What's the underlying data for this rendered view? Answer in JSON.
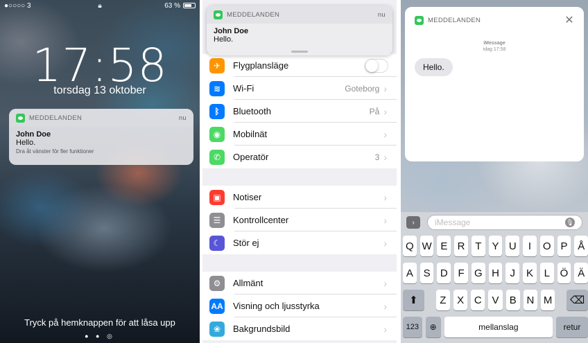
{
  "lock_screen": {
    "status_left": "●○○○○ 3",
    "status_right": "63 %",
    "time": "17:58",
    "date": "torsdag 13 oktober",
    "notification": {
      "app": "MEDDELANDEN",
      "when": "nu",
      "sender": "John Doe",
      "message": "Hello.",
      "hint": "Dra åt vänster för fler funktioner"
    },
    "unlock_text": "Tryck på hemknappen för att låsa upp"
  },
  "settings": {
    "banner": {
      "app": "MEDDELANDEN",
      "when": "nu",
      "sender": "John Doe",
      "message": "Hello."
    },
    "group1": [
      {
        "label": "Flygplansläge",
        "value": "",
        "color": "#ff9500",
        "icon": "airplane-icon",
        "glyph": "✈",
        "toggle": true
      },
      {
        "label": "Wi-Fi",
        "value": "Goteborg",
        "color": "#007aff",
        "icon": "wifi-icon",
        "glyph": "≋"
      },
      {
        "label": "Bluetooth",
        "value": "På",
        "color": "#007aff",
        "icon": "bluetooth-icon",
        "glyph": "ᛒ"
      },
      {
        "label": "Mobilnät",
        "value": "",
        "color": "#4cd964",
        "icon": "cellular-icon",
        "glyph": "◉"
      },
      {
        "label": "Operatör",
        "value": "3",
        "color": "#4cd964",
        "icon": "phone-icon",
        "glyph": "✆"
      }
    ],
    "group2": [
      {
        "label": "Notiser",
        "value": "",
        "color": "#ff3b30",
        "icon": "notifications-icon",
        "glyph": "▣"
      },
      {
        "label": "Kontrollcenter",
        "value": "",
        "color": "#8e8e93",
        "icon": "control-center-icon",
        "glyph": "☰"
      },
      {
        "label": "Stör ej",
        "value": "",
        "color": "#5856d6",
        "icon": "moon-icon",
        "glyph": "☾"
      }
    ],
    "group3": [
      {
        "label": "Allmänt",
        "value": "",
        "color": "#8e8e93",
        "icon": "gear-icon",
        "glyph": "⚙"
      },
      {
        "label": "Visning och ljusstyrka",
        "value": "",
        "color": "#007aff",
        "icon": "display-icon",
        "glyph": "AA"
      },
      {
        "label": "Bakgrundsbild",
        "value": "",
        "color": "#34aadc",
        "icon": "wallpaper-icon",
        "glyph": "❀"
      }
    ]
  },
  "reply": {
    "app": "MEDDELANDEN",
    "service": "iMessage",
    "timestamp": "idag 17:58",
    "message": "Hello.",
    "input_placeholder": "iMessage",
    "keyboard": {
      "row1": [
        "Q",
        "W",
        "E",
        "R",
        "T",
        "Y",
        "U",
        "I",
        "O",
        "P",
        "Å"
      ],
      "row2": [
        "A",
        "S",
        "D",
        "F",
        "G",
        "H",
        "J",
        "K",
        "L",
        "Ö",
        "Ä"
      ],
      "row3": [
        "Z",
        "X",
        "C",
        "V",
        "B",
        "N",
        "M"
      ],
      "numbers": "123",
      "space": "mellanslag",
      "return": "retur"
    }
  }
}
